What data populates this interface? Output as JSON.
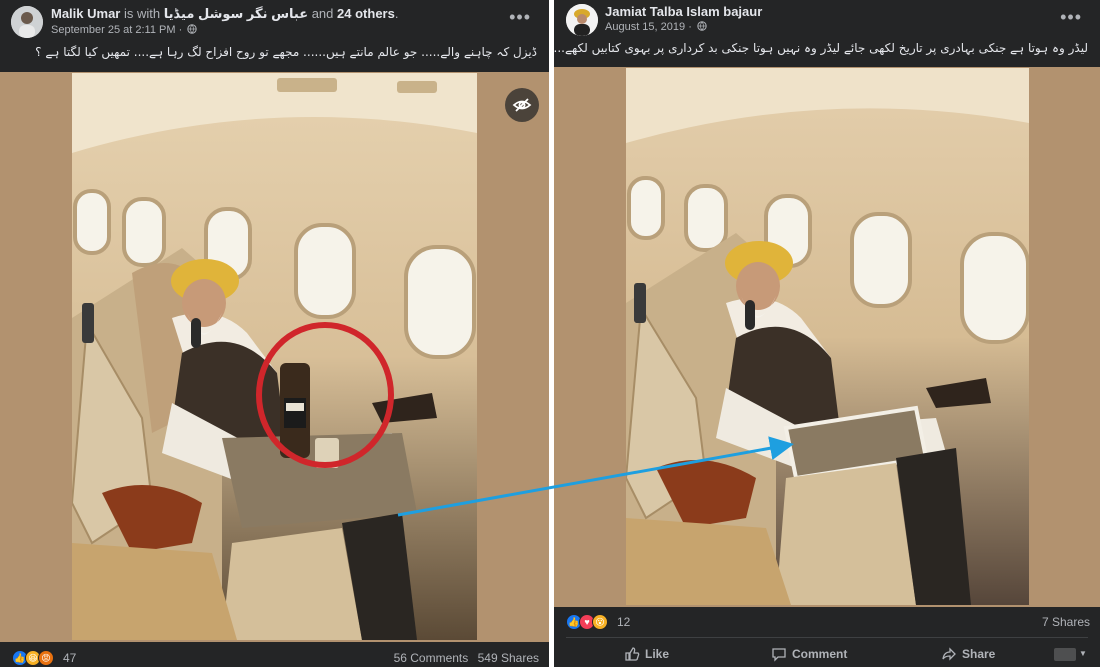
{
  "left_post": {
    "author": "Malik Umar",
    "with_text": "is with",
    "tagged_page": "عباس نگر سوشل میڈیا",
    "and_text": "and",
    "others": "24 others",
    "others_suffix": ".",
    "timestamp": "September 25 at 2:11 PM",
    "timestamp_sep": "·",
    "caption": "ڈیزل کہ چاہنے والے..... جو عالم مانتے ہیں......  مجھے تو روح افزاح لگ رہا ہے.... تمھیں کیا لگتا ہے ؟",
    "reactions_count": "47",
    "comments": "56 Comments",
    "shares": "549 Shares"
  },
  "right_post": {
    "author": "Jamiat Talba Islam bajaur",
    "timestamp": "August 15, 2019",
    "timestamp_sep": "·",
    "caption": "لیڈر وہ ہوتا ہے جنکی بہادری پر تاریخ لکھی جائے لیڈر وہ نہیں ہوتا جنکی بد کرداری پر بہوی کتابیں لکھے....",
    "reactions_count": "12",
    "shares": "7 Shares",
    "actions": {
      "like": "Like",
      "comment": "Comment",
      "share": "Share"
    }
  },
  "icons": {
    "more": "more-options-icon",
    "globe": "globe-icon",
    "eye": "hidden-eye-icon",
    "like": "like-icon",
    "comment": "comment-icon",
    "share": "share-icon"
  },
  "colors": {
    "post_bg": "#242526",
    "text": "#e4e6eb",
    "muted": "#b0b3b8",
    "photo_backdrop": "#b2926f",
    "highlight_circle": "#d0262b",
    "arrow": "#1e9fe0",
    "like_blue": "#1877f2",
    "love_red": "#f33e58",
    "wow_yellow": "#f7b125"
  }
}
